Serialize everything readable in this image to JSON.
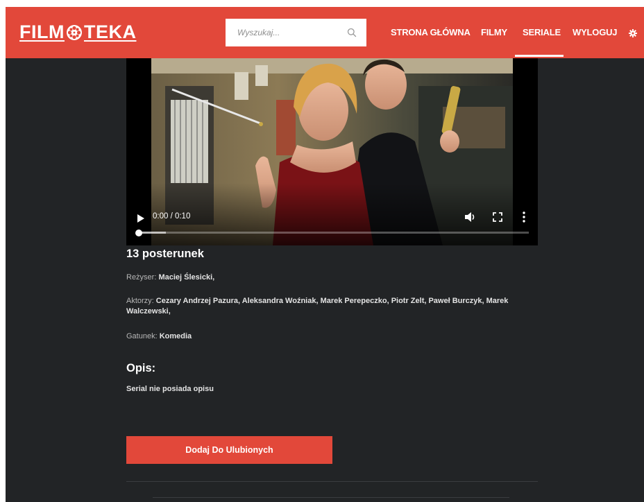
{
  "header": {
    "logo_left": "FILM",
    "logo_right": "TEKA",
    "search_placeholder": "Wyszukaj...",
    "nav": [
      {
        "label": "STRONA GŁÓWNA"
      },
      {
        "label": "FILMY"
      },
      {
        "label": "SERIALE",
        "active": true
      },
      {
        "label": "WYLOGUJ"
      }
    ],
    "accent_color": "#e2483a"
  },
  "video": {
    "time": "0:00 / 0:10",
    "progress_fraction": 0.0
  },
  "details": {
    "title": "13 posterunek",
    "director_label": "Reżyser:",
    "director_value": "Maciej Ślesicki,",
    "actors_label": "Aktorzy:",
    "actors_value": "Cezary Andrzej Pazura, Aleksandra Woźniak, Marek Perepeczko, Piotr Zelt, Paweł Burczyk, Marek Walczewski,",
    "genre_label": "Gatunek:",
    "genre_value": "Komedia"
  },
  "description": {
    "heading": "Opis:",
    "text": "Serial nie posiada opisu"
  },
  "actions": {
    "favorite_label": "Dodaj Do Ulubionych"
  },
  "icons": {
    "logo_reel": "film-reel-icon",
    "search": "search-icon",
    "settings": "gear-icon",
    "play": "play-icon",
    "volume": "volume-icon",
    "fullscreen": "fullscreen-icon",
    "more": "more-vertical-icon"
  }
}
